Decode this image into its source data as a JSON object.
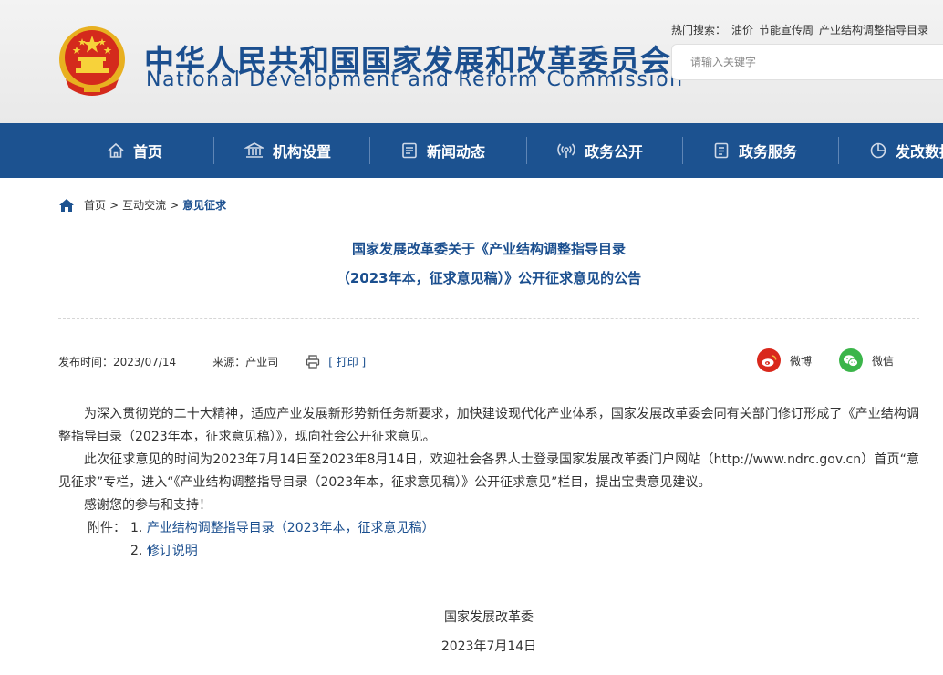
{
  "header": {
    "title_cn": "中华人民共和国国家发展和改革委员会",
    "title_en": "National Development and Reform Commission",
    "hot_label": "热门搜索：",
    "hot_items": [
      "油价",
      "节能宣传周",
      "产业结构调整指导目录"
    ],
    "search_placeholder": "请输入关键字"
  },
  "nav": {
    "items": [
      {
        "label": "首页",
        "icon": "home-icon"
      },
      {
        "label": "机构设置",
        "icon": "institution-icon"
      },
      {
        "label": "新闻动态",
        "icon": "news-icon"
      },
      {
        "label": "政务公开",
        "icon": "broadcast-icon"
      },
      {
        "label": "政务服务",
        "icon": "document-icon"
      },
      {
        "label": "发改数据",
        "icon": "pie-chart-icon"
      }
    ]
  },
  "breadcrumb": {
    "items": [
      "首页",
      "互动交流"
    ],
    "separator": ">",
    "current": "意见征求"
  },
  "article": {
    "title_line1": "国家发展改革委关于《产业结构调整指导目录",
    "title_line2": "（2023年本，征求意见稿）》公开征求意见的公告",
    "publish_label": "发布时间：",
    "publish_date": "2023/07/14",
    "source_label": "来源：",
    "source": "产业司",
    "print_label": "[ 打印 ]",
    "share_weibo": "微博",
    "share_wechat": "微信",
    "paragraphs": [
      "为深入贯彻党的二十大精神，适应产业发展新形势新任务新要求，加快建设现代化产业体系，国家发展改革委会同有关部门修订形成了《产业结构调整指导目录（2023年本，征求意见稿）》，现向社会公开征求意见。",
      "此次征求意见的时间为2023年7月14日至2023年8月14日，欢迎社会各界人士登录国家发展改革委门户网站（http://www.ndrc.gov.cn）首页“意见征求”专栏，进入“《产业结构调整指导目录（2023年本，征求意见稿）》公开征求意见”栏目，提出宝贵意见建议。",
      "感谢您的参与和支持！"
    ],
    "attachment_label": "附件：",
    "attachments": [
      {
        "num": "1.",
        "label": "产业结构调整指导目录（2023年本，征求意见稿）"
      },
      {
        "num": "2.",
        "label": "修订说明"
      }
    ],
    "signature_org": "国家发展改革委",
    "signature_date": "2023年7月14日"
  },
  "colors": {
    "brand_blue": "#1c5290",
    "title_blue": "#1b4f8f",
    "weibo_red": "#d9281c",
    "wechat_green": "#3bb54a"
  }
}
